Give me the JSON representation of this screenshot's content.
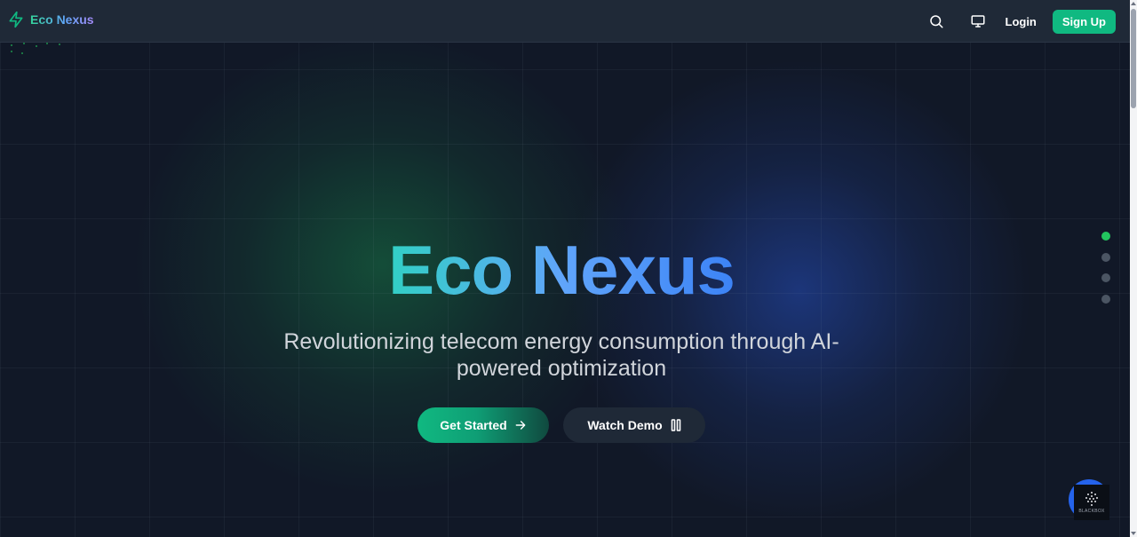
{
  "brand": {
    "name": "Eco Nexus",
    "icon": "lightning-bolt-icon",
    "accent": "#10b981"
  },
  "nav": {
    "search_icon": "search-icon",
    "display_icon": "monitor-icon",
    "login_label": "Login",
    "signup_label": "Sign Up"
  },
  "hero": {
    "title": "Eco Nexus",
    "subtitle": "Revolutionizing telecom energy consumption through AI-powered optimization",
    "primary_cta": "Get Started",
    "primary_cta_icon": "arrow-right-icon",
    "secondary_cta": "Watch Demo",
    "secondary_cta_icon": "pause-icon"
  },
  "pagination": {
    "count": 4,
    "active_index": 0
  },
  "widget": {
    "badge_text": "BLACKBOX"
  },
  "colors": {
    "background": "#111827",
    "navbar": "#1f2937",
    "primary": "#10b981",
    "title_gradient_start": "#2dd4bf",
    "title_gradient_end": "#3b82f6",
    "active_dot": "#22c55e"
  }
}
